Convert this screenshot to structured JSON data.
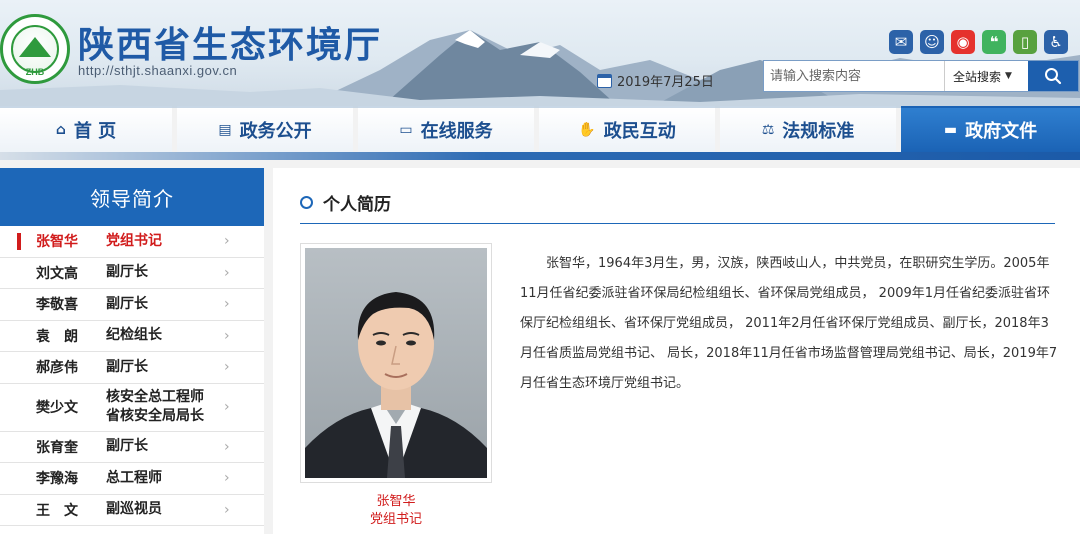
{
  "header": {
    "site_name": "陕西省生态环境厅",
    "url": "http://sthjt.shaanxi.gov.cn",
    "logo_text": "ZHB",
    "date": "2019年7月25日",
    "icons": [
      "accessibility-icon",
      "wechat-icon",
      "weibo-icon",
      "user-icon",
      "mail-icon",
      "mobile-icon"
    ]
  },
  "search": {
    "placeholder": "请输入搜索内容",
    "scope": "全站搜索",
    "scope_arrow": "▼"
  },
  "nav": [
    {
      "label": "首 页",
      "icon": "home-icon",
      "active": false
    },
    {
      "label": "政务公开",
      "icon": "list-icon",
      "active": false
    },
    {
      "label": "在线服务",
      "icon": "monitor-icon",
      "active": false
    },
    {
      "label": "政民互动",
      "icon": "handshake-icon",
      "active": false
    },
    {
      "label": "法规标准",
      "icon": "scale-icon",
      "active": false
    },
    {
      "label": "政府文件",
      "icon": "folder-icon",
      "active": true
    }
  ],
  "sidebar": {
    "title": "领导简介",
    "leaders": [
      {
        "name": "张智华",
        "post": "党组书记",
        "active": true
      },
      {
        "name": "刘文高",
        "post": "副厅长"
      },
      {
        "name": "李敬喜",
        "post": "副厅长"
      },
      {
        "name": "袁　朗",
        "post": "纪检组长"
      },
      {
        "name": "郝彦伟",
        "post": "副厅长"
      },
      {
        "name": "樊少文",
        "post": "核安全总工程师\n省核安全局局长"
      },
      {
        "name": "张育奎",
        "post": "副厅长"
      },
      {
        "name": "李豫海",
        "post": "总工程师"
      },
      {
        "name": "王　文",
        "post": "副巡视员"
      }
    ]
  },
  "main": {
    "section_title": "个人简历",
    "photo_caption_name": "张智华",
    "photo_caption_post": "党组书记",
    "bio": "张智华，1964年3月生，男，汉族，陕西岐山人，中共党员，在职研究生学历。2005年11月任省纪委派驻省环保局纪检组组长、省环保局党组成员， 2009年1月任省纪委派驻省环保厅纪检组组长、省环保厅党组成员， 2011年2月任省环保厅党组成员、副厅长，2018年3月任省质监局党组书记、 局长，2018年11月任省市场监督管理局党组书记、局长，2019年7月任省生态环境厅党组书记。"
  },
  "colors": {
    "brand_blue": "#1d67b8",
    "active_red": "#d11c1c",
    "logo_green": "#2f9a3d"
  }
}
